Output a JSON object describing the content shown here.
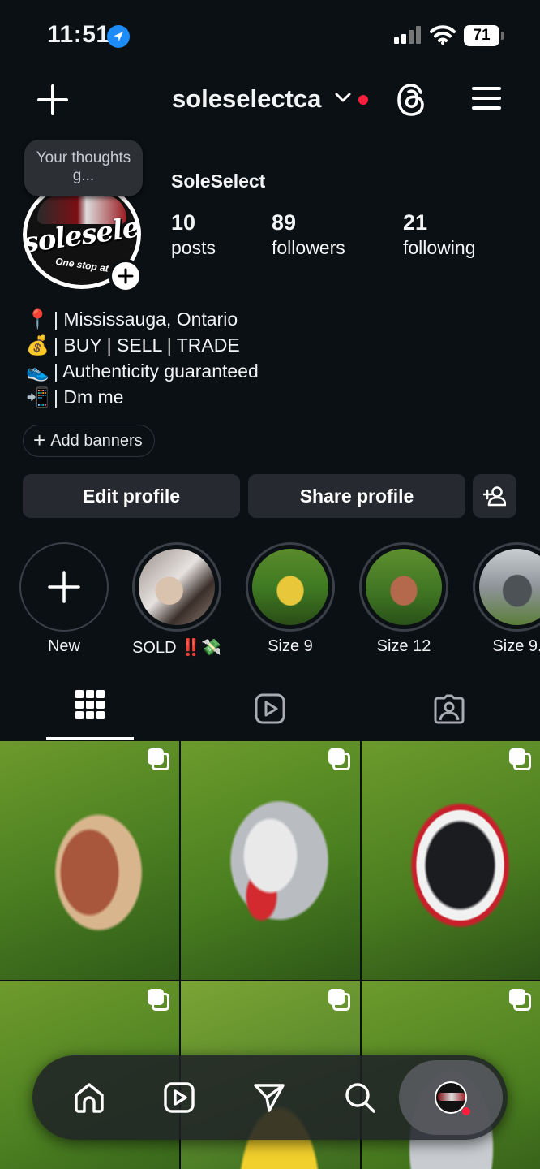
{
  "status_bar": {
    "time": "11:51",
    "battery": "71",
    "icons": [
      "location-arrow-icon",
      "cellular-signal-icon",
      "wifi-icon",
      "battery-icon"
    ]
  },
  "header": {
    "username": "soleselectca",
    "icons": [
      "plus-icon",
      "chevron-down-icon",
      "threads-icon",
      "hamburger-menu-icon"
    ],
    "notification_color": "#ff1f3d"
  },
  "profile": {
    "thought_bubble": "Your thoughts g...",
    "display_name": "SoleSelect",
    "stats": [
      {
        "num": "10",
        "label": "posts"
      },
      {
        "num": "89",
        "label": "followers"
      },
      {
        "num": "21",
        "label": "following"
      }
    ],
    "bio": [
      {
        "emoji": "📍",
        "text": "| Mississauga, Ontario"
      },
      {
        "emoji": "💰",
        "text": "| BUY | SELL | TRADE"
      },
      {
        "emoji": "👟",
        "text": "| Authenticity guaranteed"
      },
      {
        "emoji": "📲",
        "text": "| Dm me"
      }
    ],
    "add_banners": "Add banners",
    "edit_button": "Edit profile",
    "share_button": "Share profile"
  },
  "highlights": [
    {
      "caption": "New"
    },
    {
      "caption": "SOLD ‼️💸"
    },
    {
      "caption": "Size 9"
    },
    {
      "caption": "Size 12"
    },
    {
      "caption": "Size 9."
    }
  ],
  "tabs": [
    "grid-icon",
    "reels-icon",
    "tagged-icon"
  ],
  "bottom_nav": [
    "home-icon",
    "reels-icon",
    "messages-icon",
    "search-icon",
    "profile-avatar"
  ],
  "colors": {
    "background": "#0b1014",
    "button": "#262a30",
    "accent_blue": "#1d8cf8",
    "notification_red": "#ff1f3d"
  }
}
